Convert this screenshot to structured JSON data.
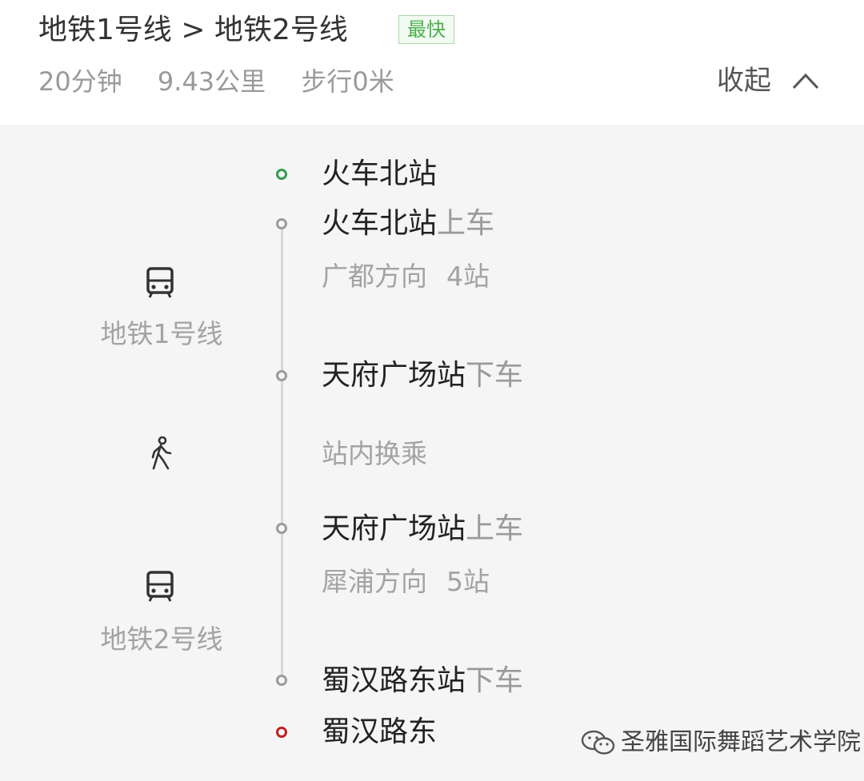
{
  "header": {
    "route_title": "地铁1号线 > 地铁2号线",
    "badge": "最快",
    "duration": "20分钟",
    "distance": "9.43公里",
    "walking": "步行0米",
    "collapse_label": "收起",
    "collapse_icon": "chevron-up-icon"
  },
  "timeline": {
    "start": {
      "name": "火车北站"
    },
    "segments": [
      {
        "mode_icon": "subway-icon",
        "line_name": "地铁1号线",
        "board": {
          "station": "火车北站",
          "action": "上车"
        },
        "direction": "广都方向",
        "stops": "4站",
        "alight": {
          "station": "天府广场站",
          "action": "下车"
        }
      },
      {
        "mode_icon": "subway-icon",
        "line_name": "地铁2号线",
        "board": {
          "station": "天府广场站",
          "action": "上车"
        },
        "direction": "犀浦方向",
        "stops": "5站",
        "alight": {
          "station": "蜀汉路东站",
          "action": "下车"
        }
      }
    ],
    "transfer": {
      "icon": "walking-person-icon",
      "text": "站内换乘"
    },
    "end": {
      "name": "蜀汉路东"
    }
  },
  "watermark": {
    "text": "圣雅国际舞蹈艺术学院",
    "icon": "wechat-icon"
  },
  "colors": {
    "start_node": "#2e9e4e",
    "end_node": "#c41e1e",
    "badge_text": "#4caf50",
    "badge_border": "#a8d8a8",
    "node_gray": "#9b9b9b"
  }
}
